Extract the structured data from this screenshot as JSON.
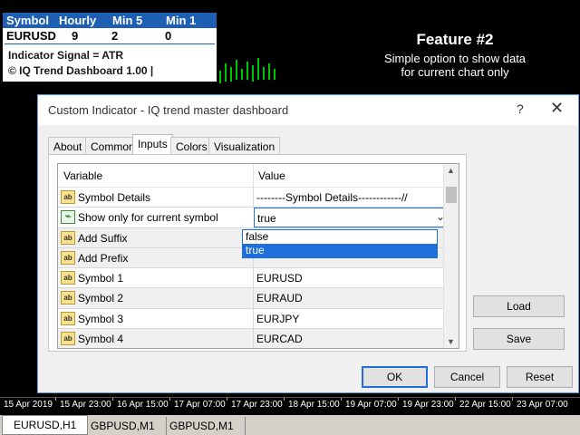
{
  "dashboard": {
    "headers": [
      "Symbol",
      "Hourly",
      "Min 5",
      "Min 1"
    ],
    "row": {
      "symbol": "EURUSD",
      "hourly": "9",
      "min5": "2",
      "min1": "0"
    },
    "signal": "Indicator Signal = ATR",
    "copyright": "© IQ Trend Dashboard 1.00 |"
  },
  "feature": {
    "title": "Feature #2",
    "subtitle_line1": "Simple option to show data",
    "subtitle_line2": "for current chart only"
  },
  "dialog": {
    "title": "Custom Indicator - IQ trend master dashboard",
    "help": "?",
    "close": "✕",
    "tabs": [
      "About",
      "Common",
      "Inputs",
      "Colors",
      "Visualization"
    ],
    "active_tab": "Inputs",
    "columns": {
      "variable": "Variable",
      "value": "Value"
    },
    "rows": [
      {
        "name": "Symbol Details",
        "value": "--------Symbol Details------------//",
        "icon": "ab-icon"
      },
      {
        "name": "Show only for current symbol",
        "value": "true",
        "icon": "boolean-icon"
      },
      {
        "name": "Add Suffix",
        "value": "",
        "icon": "ab-icon"
      },
      {
        "name": "Add Prefix",
        "value": "",
        "icon": "ab-icon"
      },
      {
        "name": "Symbol 1",
        "value": "EURUSD",
        "icon": "ab-icon"
      },
      {
        "name": "Symbol 2",
        "value": "EURAUD",
        "icon": "ab-icon"
      },
      {
        "name": "Symbol 3",
        "value": "EURJPY",
        "icon": "ab-icon"
      },
      {
        "name": "Symbol 4",
        "value": "EURCAD",
        "icon": "ab-icon"
      }
    ],
    "dropdown_options": [
      "false",
      "true"
    ],
    "dropdown_selected": "true",
    "buttons": {
      "load": "Load",
      "save": "Save",
      "ok": "OK",
      "cancel": "Cancel",
      "reset": "Reset"
    }
  },
  "time_axis": [
    "15 Apr 2019",
    "15 Apr 23:00",
    "16 Apr 15:00",
    "17 Apr 07:00",
    "17 Apr 23:00",
    "18 Apr 15:00",
    "19 Apr 07:00",
    "19 Apr 23:00",
    "22 Apr 15:00",
    "23 Apr 07:00"
  ],
  "sheet_tabs": [
    "EURUSD,H1",
    "GBPUSD,M1",
    "GBPUSD,M1"
  ],
  "colors": {
    "header_blue": "#1e5fb4",
    "accent": "#1e6fd9",
    "candle_green": "#00c800"
  }
}
